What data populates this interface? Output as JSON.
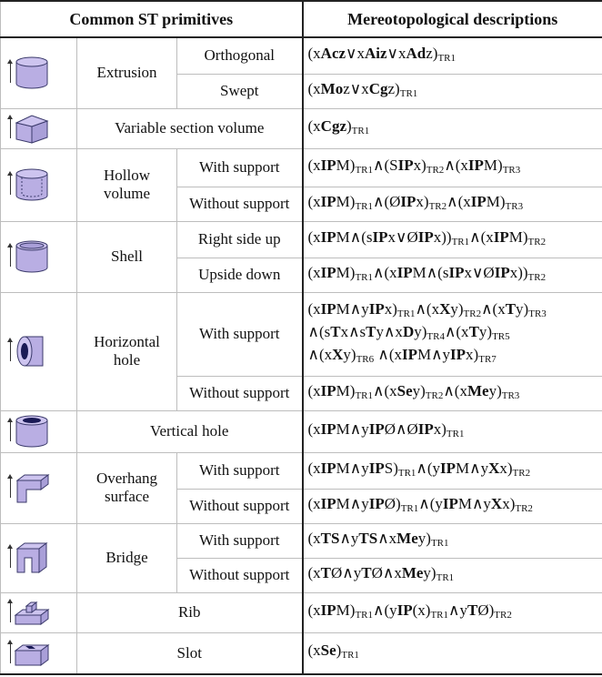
{
  "header": {
    "col1": "Common ST primitives",
    "col2": "Mereotopological descriptions"
  },
  "axis_label": "z",
  "rows": {
    "extrusion": {
      "name": "Extrusion",
      "sub1": "Orthogonal",
      "desc1": "(xAcz∨xAiz∨xAdz)TR1",
      "sub2": "Swept",
      "desc2": "(xMoz∨xCgz)TR1"
    },
    "variable": {
      "name": "Variable section volume",
      "desc": "(xCgz)TR1"
    },
    "hollow": {
      "name": "Hollow volume",
      "sub1": "With support",
      "desc1": "(xIPM)TR1∧(SIPx)TR2∧(xIPM)TR3",
      "sub2": "Without support",
      "desc2": "(xIPM)TR1∧(ØIPx)TR2∧(xIPM)TR3"
    },
    "shell": {
      "name": "Shell",
      "sub1": "Right side up",
      "desc1": "(xIPM∧(sIPx∨ØIPx))TR1∧(xIPM)TR2",
      "sub2": "Upside down",
      "desc2": "(xIPM)TR1∧(xIPM∧(sIPx∨ØIPx))TR2"
    },
    "horizontal": {
      "name": "Horizontal hole",
      "sub1": "With support",
      "desc1": "(xIPM∧yIPx)TR1∧(xXy)TR2∧(xTy)TR3 ∧(sTx∧sTy∧xDy)TR4∧(xTy)TR5 ∧(xXy)TR6 ∧(xIPM∧yIPx)TR7",
      "sub2": "Without support",
      "desc2": "(xIPM)TR1∧(xSey)TR2∧(xMey)TR3"
    },
    "vertical": {
      "name": "Vertical hole",
      "desc": "(xIPM∧yIPØ∧ØIPx)TR1"
    },
    "overhang": {
      "name": "Overhang surface",
      "sub1": "With support",
      "desc1": "(xIPM∧yIPS)TR1∧(yIPM∧yXx)TR2",
      "sub2": "Without support",
      "desc2": "(xIPM∧yIPØ)TR1∧(yIPM∧yXx)TR2"
    },
    "bridge": {
      "name": "Bridge",
      "sub1": "With support",
      "desc1": "(xTS∧yTS∧xMey)TR1",
      "sub2": "Without support",
      "desc2": "(xTØ∧yTØ∧xMey)TR1"
    },
    "rib": {
      "name": "Rib",
      "desc": "(xIPM)TR1∧(yIP(x)TR1∧yTØ)TR2"
    },
    "slot": {
      "name": "Slot",
      "desc": "(xSe)TR1"
    }
  },
  "colors": {
    "fill": "#b9aee3",
    "stroke": "#3b3a6b",
    "dark": "#1a1a55"
  }
}
